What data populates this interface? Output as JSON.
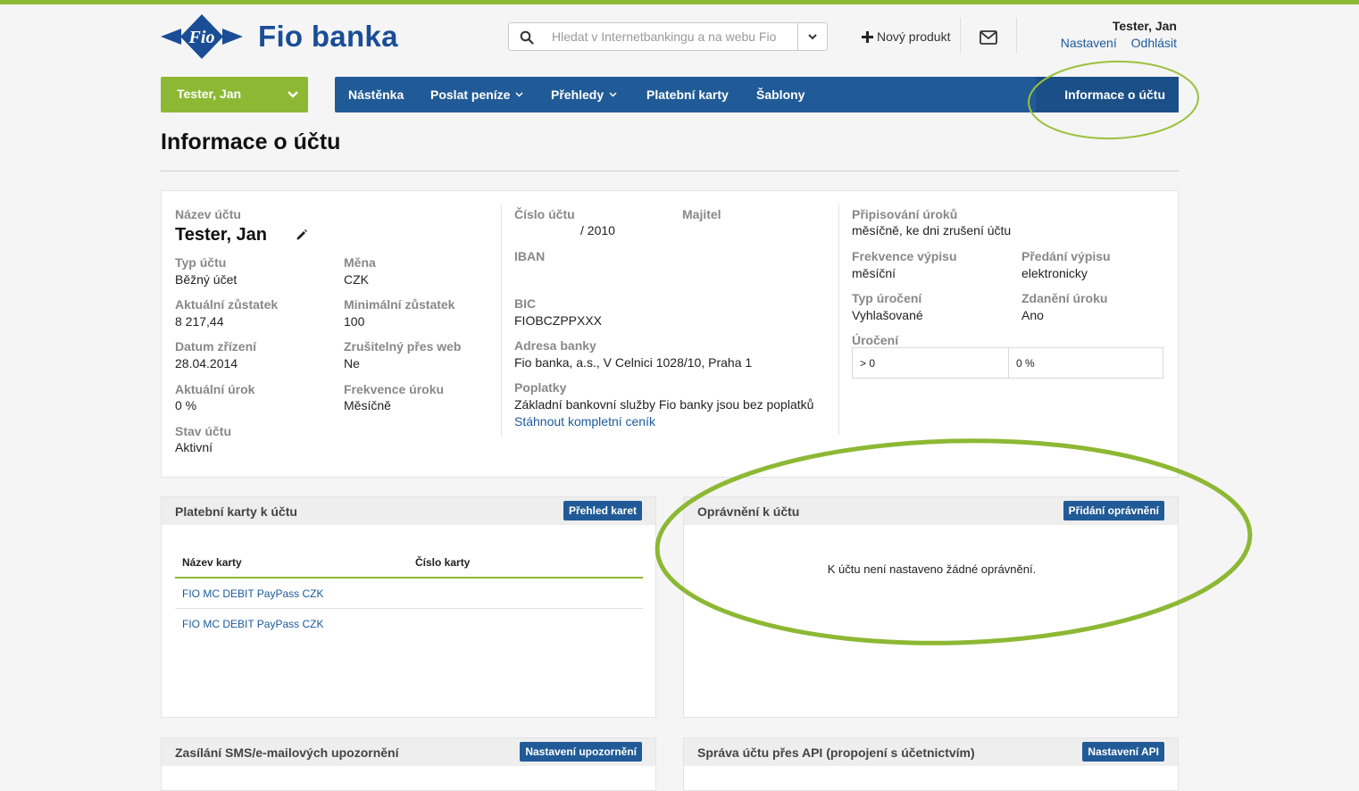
{
  "brand": {
    "name": "Fio banka",
    "logo_text": "Fio",
    "accent": "#8db834",
    "primary": "#215b97"
  },
  "header": {
    "search_placeholder": "Hledat v Internetbankingu a na webu Fio",
    "new_product": "Nový produkt",
    "user_name": "Tester, Jan",
    "settings": "Nastavení",
    "logout": "Odhlásit"
  },
  "account_selector": "Tester, Jan",
  "nav": {
    "items": [
      "Nástěnka",
      "Poslat peníze",
      "Přehledy",
      "Platební karty",
      "Šablony"
    ],
    "active": "Informace o účtu"
  },
  "page_title": "Informace o účtu",
  "info": {
    "name_label": "Název účtu",
    "name_value": "Tester, Jan",
    "type_label": "Typ účtu",
    "type_value": "Běžný účet",
    "currency_label": "Měna",
    "currency_value": "CZK",
    "balance_label": "Aktuální zůstatek",
    "balance_value": "8 217,44",
    "min_balance_label": "Minimální zůstatek",
    "min_balance_value": "100",
    "created_label": "Datum zřízení",
    "created_value": "28.04.2014",
    "cancelable_label": "Zrušitelný přes web",
    "cancelable_value": "Ne",
    "rate_label": "Aktuální úrok",
    "rate_value": "0 %",
    "rate_freq_label": "Frekvence úroku",
    "rate_freq_value": "Měsíčně",
    "status_label": "Stav účtu",
    "status_value": "Aktivní",
    "number_label": "Číslo účtu",
    "number_value": "/ 2010",
    "owner_label": "Majitel",
    "iban_label": "IBAN",
    "bic_label": "BIC",
    "bic_value": "FIOBCZPPXXX",
    "bank_addr_label": "Adresa banky",
    "bank_addr_value": "Fio banka, a.s., V Celnici 1028/10, Praha 1",
    "fees_label": "Poplatky",
    "fees_value": "Základní bankovní služby Fio banky jsou bez poplatků",
    "fees_link": "Stáhnout kompletní ceník",
    "interest_credit_label": "Připisování úroků",
    "interest_credit_value": "měsíčně, ke dni zrušení účtu",
    "stmt_freq_label": "Frekvence výpisu",
    "stmt_freq_value": "měsíční",
    "stmt_delivery_label": "Předání výpisu",
    "stmt_delivery_value": "elektronicky",
    "rate_type_label": "Typ úročení",
    "rate_type_value": "Vyhlašované",
    "tax_label": "Zdanění úroku",
    "tax_value": "Ano",
    "interest_label": "Úročení",
    "interest_row": [
      "> 0",
      "0 %"
    ]
  },
  "cards_box": {
    "title": "Platební karty k účtu",
    "button": "Přehled karet",
    "columns": [
      "Název karty",
      "Číslo karty"
    ],
    "rows": [
      "FIO MC DEBIT PayPass CZK",
      "FIO MC DEBIT PayPass CZK"
    ]
  },
  "permissions_box": {
    "title": "Oprávnění k účtu",
    "button": "Přidání oprávnění",
    "empty": "K účtu není nastaveno žádné oprávnění."
  },
  "sms_box": {
    "title": "Zasílání SMS/e-mailových upozornění",
    "button": "Nastavení upozornění"
  },
  "api_box": {
    "title": "Správa účtu přes API (propojení s účetnictvím)",
    "button": "Nastavení API"
  }
}
